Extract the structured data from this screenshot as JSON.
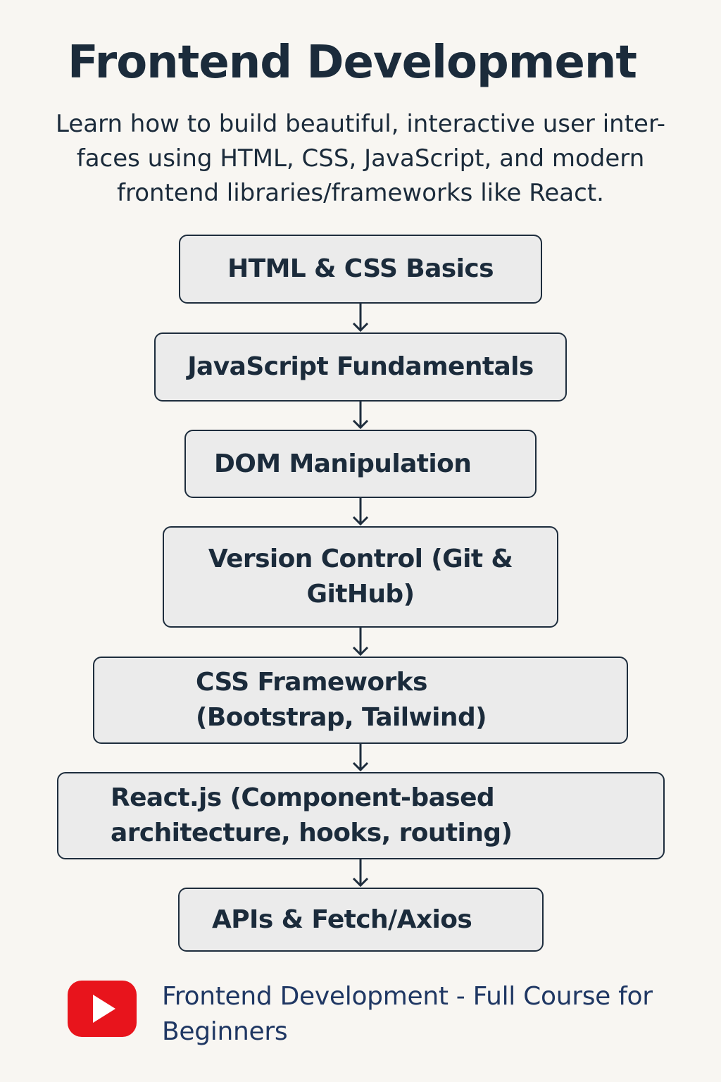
{
  "title": "Frontend Development",
  "intro": "Learn how to build beautiful, interactive user inter-faces using HTML, CSS, JavaScript, and modern frontend libraries/frameworks like React.",
  "steps": [
    {
      "label": "HTML & CSS Basics"
    },
    {
      "label": "JavaScript Fundamentals"
    },
    {
      "label": "DOM Manipulation"
    },
    {
      "label": "Version Control (Git & GitHub)"
    },
    {
      "label": "CSS Frameworks (Bootstrap, Tailwind)"
    },
    {
      "label": "React.js (Component-based architecture, hooks, routing)"
    },
    {
      "label": "APIs & Fetch/Axios"
    }
  ],
  "footer": {
    "icon": "youtube-play-icon",
    "text": "Frontend Development - Full Course for Beginners"
  },
  "colors": {
    "background": "#f8f6f2",
    "text": "#1b2b3b",
    "box_fill": "#ebebeb",
    "box_border": "#1e2d3d",
    "footer_text": "#1f3763",
    "youtube_red": "#e8141c"
  }
}
